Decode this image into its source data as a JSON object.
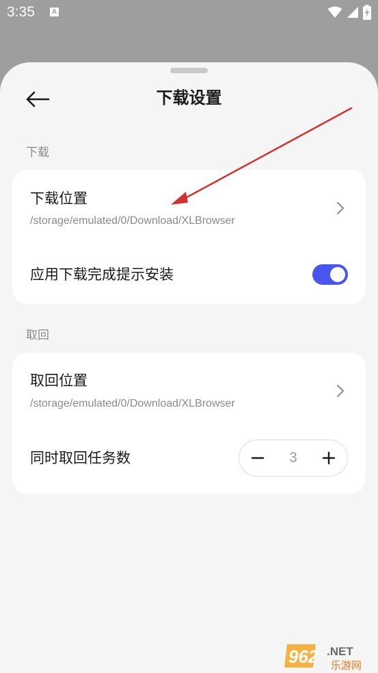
{
  "status_bar": {
    "time": "3:35",
    "notification_icon_letter": "A",
    "icons": [
      "wifi-icon",
      "signal-icon",
      "battery-charging-icon"
    ]
  },
  "header": {
    "title": "下载设置",
    "back_icon": "arrow-left-icon"
  },
  "sections": {
    "download": {
      "label": "下载",
      "location_title": "下载位置",
      "location_path": "/storage/emulated/0/Download/XLBrowser",
      "install_prompt_label": "应用下载完成提示安装",
      "install_prompt_enabled": true
    },
    "retrieve": {
      "label": "取回",
      "location_title": "取回位置",
      "location_path": "/storage/emulated/0/Download/XLBrowser",
      "concurrent_label": "同时取回任务数",
      "concurrent_value": "3",
      "minus_symbol": "−",
      "plus_symbol": "+"
    }
  },
  "colors": {
    "accent": "#4a55f0",
    "annotation": "#d32f2f",
    "scrim": "#9e9e9e",
    "sheet": "#f5f5f5"
  },
  "watermark": {
    "text": "962.NET",
    "subtext": "乐游网"
  }
}
